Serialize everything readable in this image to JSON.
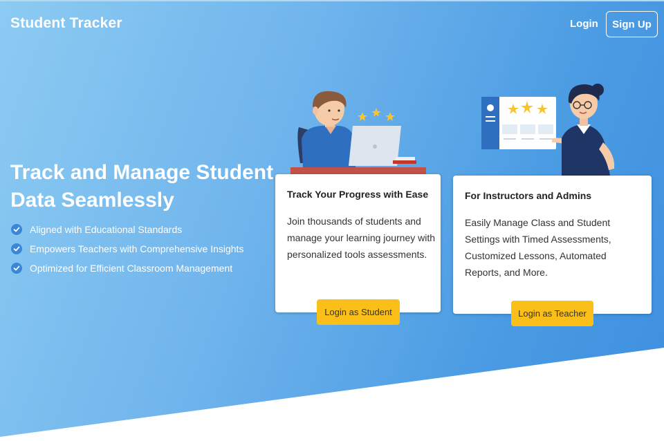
{
  "nav": {
    "brand": "Student Tracker",
    "login_label": "Login",
    "signup_label": "Sign Up"
  },
  "hero": {
    "headline": "Track and Manage Student Data Seamlessly",
    "features": [
      "Aligned with Educational Standards",
      "Empowers Teachers with Comprehensive Insights",
      "Optimized for Efficient Classroom Management"
    ]
  },
  "cards": {
    "student": {
      "title": "Track Your Progress with Ease",
      "body": "Join thousands of students and manage your learning journey with personalized tools assessments.",
      "button": "Login as Student"
    },
    "teacher": {
      "title": "For Instructors and Admins",
      "body": "Easily Manage Class and Student Settings with Timed Assessments, Customized Lessons, Automated Reports, and More.",
      "button": "Login as Teacher"
    }
  },
  "colors": {
    "accent_button": "#fbbf1a",
    "hero_gradient_start": "#8ccbf2",
    "hero_gradient_end": "#3e8fdf"
  }
}
